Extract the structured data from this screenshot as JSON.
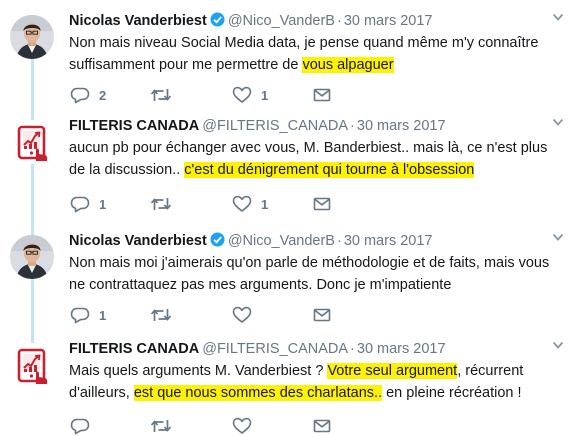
{
  "tweets": [
    {
      "name": "Nicolas Vanderbiest",
      "verified": true,
      "handle": "@Nico_VanderB",
      "date": "30 mars 2017",
      "avatar": "person-photo",
      "text": [
        {
          "t": "Non mais niveau Social Media data, je pense quand même m'y connaître suffisamment pour me permettre de ",
          "h": false
        },
        {
          "t": "vous alpaguer",
          "h": true
        }
      ],
      "replies": "2",
      "retweets": "",
      "likes": "1"
    },
    {
      "name": "FILTERIS CANADA",
      "verified": false,
      "handle": "@FILTERIS_CANADA",
      "date": "30 mars 2017",
      "avatar": "filteris-logo",
      "text": [
        {
          "t": "aucun pb pour échanger avec vous, M. Banderbiest.. mais là, ce n'est plus de la discussion.. ",
          "h": false
        },
        {
          "t": "c'est du dénigrement qui tourne à l'obsession",
          "h": true
        }
      ],
      "replies": "1",
      "retweets": "",
      "likes": "1"
    },
    {
      "name": "Nicolas Vanderbiest",
      "verified": true,
      "handle": "@Nico_VanderB",
      "date": "30 mars 2017",
      "avatar": "person-photo",
      "text": [
        {
          "t": "Non mais moi j'aimerais qu'on parle de méthodologie et de faits, mais vous ne contrattaquez pas mes arguments. Donc je m'impatiente",
          "h": false
        }
      ],
      "replies": "1",
      "retweets": "",
      "likes": ""
    },
    {
      "name": "FILTERIS CANADA",
      "verified": false,
      "handle": "@FILTERIS_CANADA",
      "date": "30 mars 2017",
      "avatar": "filteris-logo",
      "text": [
        {
          "t": "Mais quels arguments M. Vanderbiest ? ",
          "h": false
        },
        {
          "t": "Votre seul argument",
          "h": true
        },
        {
          "t": ", récurrent d'ailleurs, ",
          "h": false
        },
        {
          "t": "est que nous sommes des charlatans..",
          "h": true
        },
        {
          "t": " en pleine récréation !",
          "h": false
        }
      ],
      "replies": "",
      "retweets": "",
      "likes": ""
    }
  ],
  "separator": "·",
  "icons": {
    "reply": "reply-icon",
    "retweet": "retweet-icon",
    "like": "heart-icon",
    "dm": "envelope-icon",
    "more": "chevron-down-icon",
    "verified": "verified-badge-icon"
  },
  "colors": {
    "text": "#14171a",
    "muted": "#657786",
    "verified": "#1da1f2",
    "thread": "#c4e3f3",
    "highlight": "#fff200",
    "filteris_red": "#c8202f"
  }
}
